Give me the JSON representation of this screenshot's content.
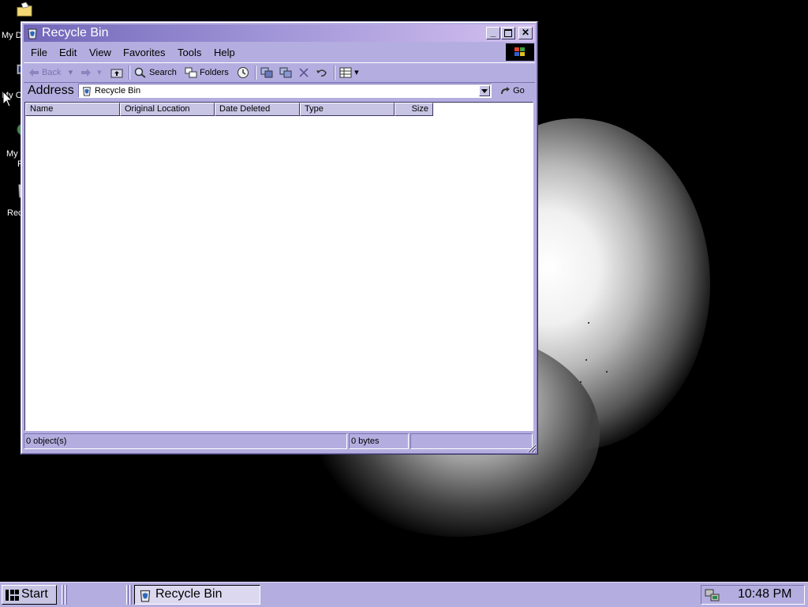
{
  "desktop": {
    "icons": [
      {
        "label": "My D"
      },
      {
        "label": "My C"
      },
      {
        "label": "My"
      },
      {
        "label": "F"
      },
      {
        "label": "Rec"
      }
    ]
  },
  "window": {
    "title": "Recycle Bin",
    "menu": [
      "File",
      "Edit",
      "View",
      "Favorites",
      "Tools",
      "Help"
    ],
    "toolbar": {
      "back": "Back",
      "search": "Search",
      "folders": "Folders"
    },
    "address": {
      "label": "Address",
      "value": "Recycle Bin",
      "go": "Go"
    },
    "columns": [
      "Name",
      "Original Location",
      "Date Deleted",
      "Type",
      "Size"
    ],
    "status": {
      "objects": "0 object(s)",
      "size": "0 bytes"
    }
  },
  "taskbar": {
    "start": "Start",
    "task": "Recycle Bin",
    "clock": "10:48 PM"
  },
  "colors": {
    "chrome": "#b4aee0",
    "title_start": "#7166b8",
    "title_end": "#d4c0f0"
  }
}
